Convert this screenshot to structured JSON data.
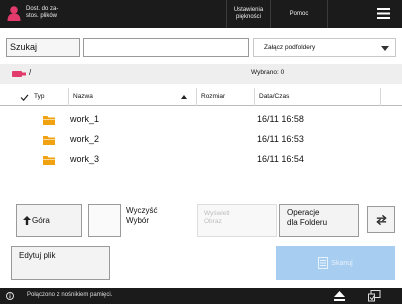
{
  "topbar": {
    "user_label": "Dost. do za-\nstos. plików",
    "settings_label": "Ustawienia\npiękności",
    "help_label": "Pomoc"
  },
  "search": {
    "button_label": "Szukaj",
    "input_value": "",
    "subfolder_option": "Załącz podfoldery"
  },
  "path_bar": {
    "path": "/",
    "selected_count": "Wybrano: 0"
  },
  "table": {
    "columns": {
      "type": "Typ",
      "name": "Nazwa",
      "size": "Rozmiar",
      "date": "Data/Czas"
    },
    "rows": [
      {
        "name": "work_1",
        "size": "",
        "date": "16/11  16:58"
      },
      {
        "name": "work_2",
        "size": "",
        "date": "16/11  16:53"
      },
      {
        "name": "work_3",
        "size": "",
        "date": "16/11  16:54"
      }
    ]
  },
  "actions": {
    "up_label": "Góra",
    "clear_selection_label": "Wyczyść\nWybór",
    "preview_label": "Wyświetl\nObraz",
    "folder_ops_label": "Operacje\ndla Folderu",
    "edit_file_label": "Edytuj plik",
    "scan_label": "Skanuj"
  },
  "status": {
    "text": "Połączono z nośnikiem pamięci."
  },
  "colors": {
    "topbar": "#1b1b1b",
    "user_icon": "#e23a6a",
    "folder": "#f0a212",
    "scan_button": "#a7cdf0",
    "path_bar": "#eeeeee"
  }
}
